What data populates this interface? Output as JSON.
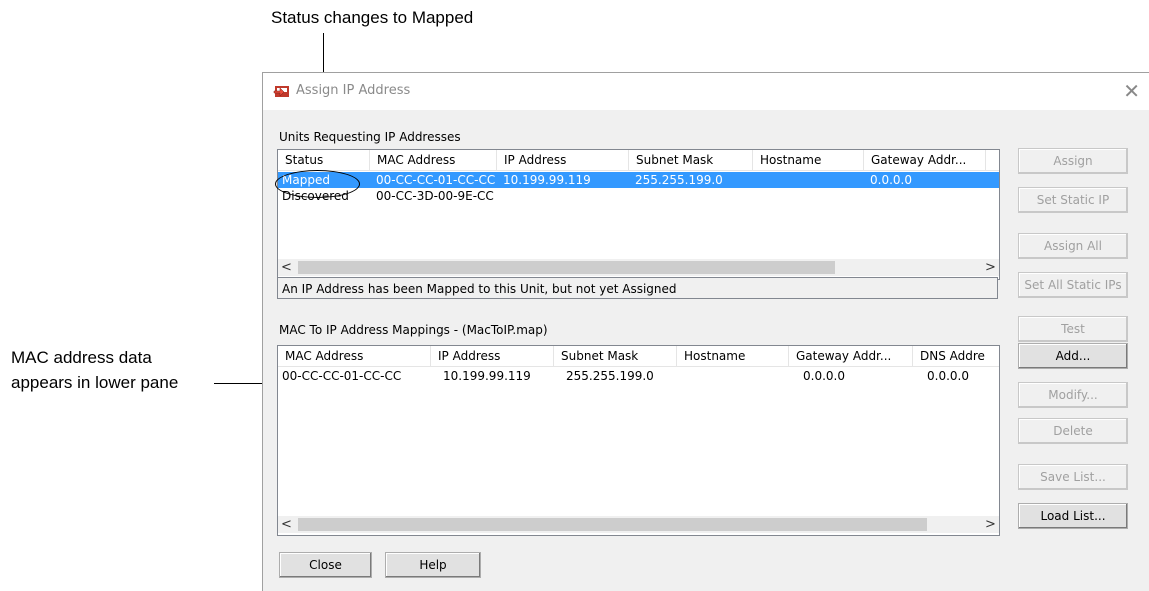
{
  "annotations": {
    "top": "Status changes to Mapped",
    "left_line1": "MAC address data",
    "left_line2": "appears in lower pane"
  },
  "window": {
    "title": "Assign IP Address",
    "title_icon": "network-adapter-icon",
    "close_glyph": "✕"
  },
  "units": {
    "label": "Units Requesting IP Addresses",
    "columns": [
      "Status",
      "MAC Address",
      "IP Address",
      "Subnet Mask",
      "Hostname",
      "Gateway Addr..."
    ],
    "rows": [
      {
        "status": "Mapped",
        "mac": "00-CC-CC-01-CC-CC",
        "ip": "10.199.99.119",
        "subnet": "255.255.199.0",
        "hostname": "",
        "gateway": "0.0.0.0",
        "selected": true
      },
      {
        "status": "Discovered",
        "mac": "00-CC-3D-00-9E-CC",
        "ip": "",
        "subnet": "",
        "hostname": "",
        "gateway": "",
        "selected": false
      }
    ],
    "status_text": "An IP Address has been Mapped to this Unit, but not yet Assigned"
  },
  "mappings": {
    "label": "MAC To IP Address Mappings - (MacToIP.map)",
    "columns": [
      "MAC Address",
      "IP Address",
      "Subnet Mask",
      "Hostname",
      "Gateway Addr...",
      "DNS Addre"
    ],
    "rows": [
      {
        "mac": "00-CC-CC-01-CC-CC",
        "ip": "10.199.99.119",
        "subnet": "255.255.199.0",
        "hostname": "",
        "gateway": "0.0.0.0",
        "dns": "0.0.0.0"
      }
    ]
  },
  "buttons": {
    "assign": "Assign",
    "set_static_ip": "Set Static IP",
    "assign_all": "Assign All",
    "set_all_static": "Set All Static IPs",
    "test": "Test",
    "add": "Add...",
    "modify": "Modify...",
    "delete": "Delete",
    "save_list": "Save List...",
    "load_list": "Load List...",
    "close": "Close",
    "help": "Help"
  },
  "scroll": {
    "left_arrow": "<",
    "right_arrow": ">"
  },
  "colors": {
    "selection": "#3399ff",
    "disabled_text": "#a0a0a0"
  }
}
